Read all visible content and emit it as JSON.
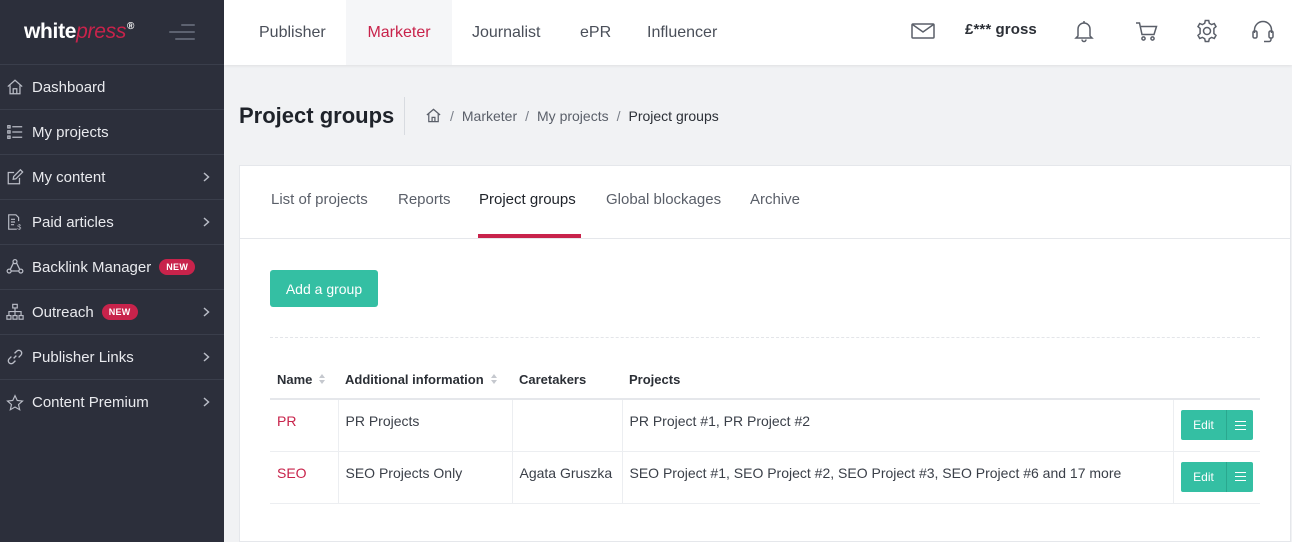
{
  "sidebar": {
    "logo": {
      "white": "white",
      "press": "press",
      "reg": "®"
    },
    "items": [
      {
        "label": "Dashboard",
        "icon": "home-icon",
        "chevron": false
      },
      {
        "label": "My projects",
        "icon": "list-icon",
        "chevron": false
      },
      {
        "label": "My content",
        "icon": "edit-icon",
        "chevron": true
      },
      {
        "label": "Paid articles",
        "icon": "document-money-icon",
        "chevron": true
      },
      {
        "label": "Backlink Manager",
        "icon": "network-icon",
        "chevron": false,
        "badge": "NEW"
      },
      {
        "label": "Outreach",
        "icon": "sitemap-icon",
        "chevron": true,
        "badge": "NEW"
      },
      {
        "label": "Publisher Links",
        "icon": "link-icon",
        "chevron": true
      },
      {
        "label": "Content Premium",
        "icon": "star-icon",
        "chevron": true
      }
    ]
  },
  "topbar": {
    "roles": [
      "Publisher",
      "Marketer",
      "Journalist",
      "ePR",
      "Influencer"
    ],
    "active_role": "Marketer",
    "balance": "£*** gross",
    "icons": [
      "mail-icon",
      "bell-icon",
      "cart-icon",
      "gear-icon",
      "headset-icon"
    ]
  },
  "page": {
    "title": "Project groups",
    "breadcrumb": [
      "Marketer",
      "My projects",
      "Project groups"
    ]
  },
  "tabs": [
    "List of projects",
    "Reports",
    "Project groups",
    "Global blockages",
    "Archive"
  ],
  "active_tab": "Project groups",
  "add_button": "Add a group",
  "table": {
    "headers": [
      "Name",
      "Additional information",
      "Caretakers",
      "Projects"
    ],
    "rows": [
      {
        "name": "PR",
        "info": "PR Projects",
        "caretakers": "",
        "projects": "PR Project #1, PR Project #2",
        "edit": "Edit"
      },
      {
        "name": "SEO",
        "info": "SEO Projects Only",
        "caretakers": "Agata Gruszka",
        "projects": "SEO Project #1, SEO Project #2, SEO Project #3, SEO Project #6 and 17 more",
        "edit": "Edit"
      }
    ]
  },
  "colors": {
    "accent": "#c8234b",
    "primary_button": "#34bfa3",
    "sidebar_bg": "#2c2f3b"
  }
}
